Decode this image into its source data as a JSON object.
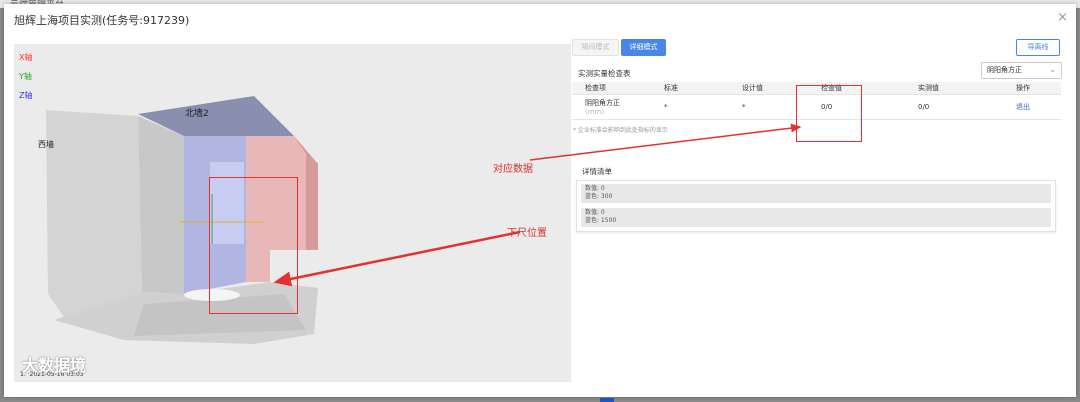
{
  "background": {
    "text": "云端管理平台"
  },
  "modal": {
    "title": "旭辉上海项目实测(任务号:917239)",
    "close": "×"
  },
  "viewer": {
    "axes": [
      {
        "label": "X轴",
        "color": "#ff3333"
      },
      {
        "label": "Y轴",
        "color": "#22aa22"
      },
      {
        "label": "Z轴",
        "color": "#3333ff"
      }
    ],
    "wall_labels": {
      "north": "北墙2",
      "west": "西墙"
    },
    "bottom_text": "1. ·2021-05-16 03:03",
    "watermark": "大数据境"
  },
  "toolbar": {
    "simple_mode": "隔间模式",
    "detail_mode": "详细模式",
    "report": "导离线"
  },
  "inspection": {
    "title": "实测实量检查表",
    "selected": "阴阳角方正",
    "columns": [
      "检查项",
      "标准",
      "设计值",
      "检查值",
      "实测值",
      "操作"
    ],
    "rows": [
      {
        "item": "阴阳角方正",
        "unit": "(mm)",
        "standard": "*",
        "design": "*",
        "check": "0/0",
        "measured": "0/0",
        "action": "退出"
      }
    ],
    "note": "* 企业标准会影响到此处指标的显示"
  },
  "detail": {
    "title": "详情清单",
    "items": [
      {
        "line1": "数值: 0",
        "line2": "蓝色: 300"
      },
      {
        "line1": "数值: 0",
        "line2": "蓝色: 1500"
      }
    ]
  },
  "annotations": {
    "data_label": "对应数据",
    "ruler_label": "下尺位置"
  }
}
